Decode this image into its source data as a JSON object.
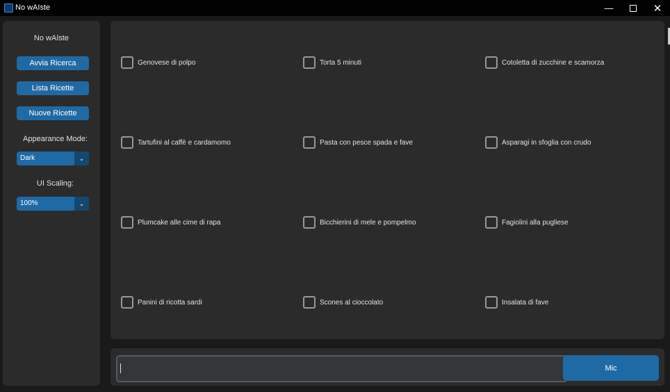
{
  "window": {
    "title": "No wAIste",
    "controls": {
      "minimize": "—",
      "close": "✕"
    }
  },
  "sidebar": {
    "title": "No wAIste",
    "buttons": [
      "Avvia Ricerca",
      "Lista Ricette",
      "Nuove Ricette"
    ],
    "appearance_label": "Appearance Mode:",
    "appearance_value": "Dark",
    "scaling_label": "UI Scaling:",
    "scaling_value": "100%",
    "dropdown_arrow": "⌄"
  },
  "recipes": [
    "Genovese di polpo",
    "Torta 5 minuti",
    "Cotoletta di zucchine e scamorza",
    "Tartufini al caffè e cardamomo",
    "Pasta con pesce spada e fave",
    "Asparagi in sfoglia con crudo",
    "Plumcake alle cime di rapa",
    "Bicchierini di mele e pompelmo",
    "Fagiolini alla pugliese",
    "Panini di ricotta sardi",
    "Scones al cioccolato",
    "Insalata di fave"
  ],
  "input": {
    "value": ""
  },
  "mic_button": "Mic",
  "colors": {
    "accent": "#1f6aa5",
    "panel": "#2b2b2b",
    "background": "#1a1a1a",
    "text": "#dce4ee"
  }
}
